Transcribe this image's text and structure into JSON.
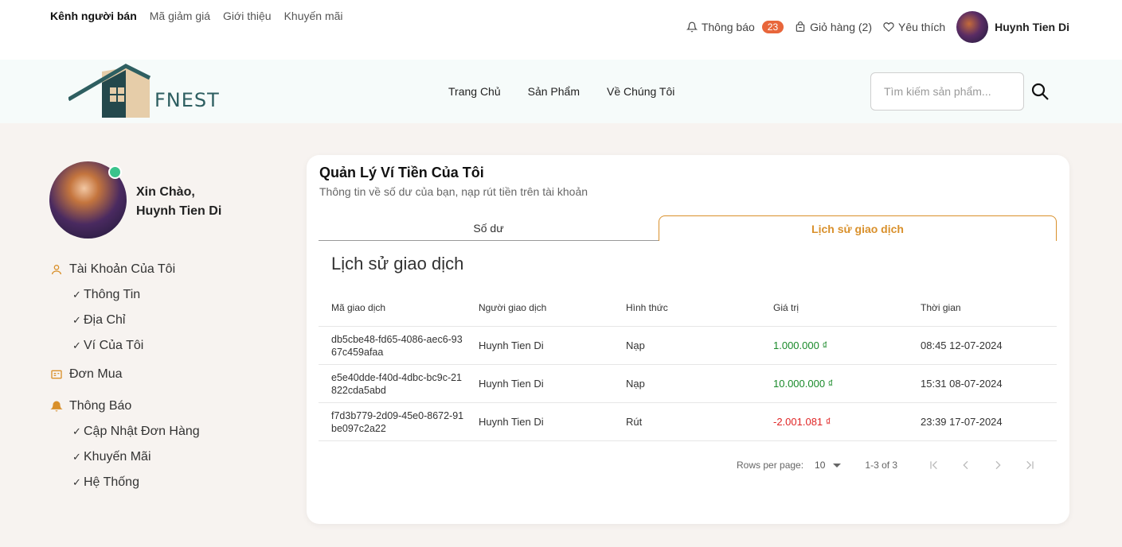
{
  "topbar": {
    "left_links": [
      "Kênh người bán",
      "Mã giảm giá",
      "Giới thiệu",
      "Khuyến mãi"
    ],
    "notifications_label": "Thông báo",
    "notifications_count": "23",
    "cart_label": "Giỏ hàng (2)",
    "favorites_label": "Yêu thích",
    "user_name": "Huynh Tien Di"
  },
  "nav": {
    "logo_text": "FNEST",
    "links": [
      "Trang Chủ",
      "Sản Phẩm",
      "Về Chúng Tôi"
    ],
    "search_placeholder": "Tìm kiếm sản phẩm..."
  },
  "sidebar": {
    "greeting_line1": "Xin Chào,",
    "greeting_line2": "Huynh Tien Di",
    "account": {
      "label": "Tài Khoản Của Tôi",
      "items": [
        "Thông Tin",
        "Địa Chỉ",
        "Ví Của Tôi"
      ]
    },
    "orders_label": "Đơn Mua",
    "notifications": {
      "label": "Thông Báo",
      "items": [
        "Cập Nhật Đơn Hàng",
        "Khuyến Mãi",
        "Hệ Thống"
      ]
    }
  },
  "card": {
    "title": "Quản Lý Ví Tiền Của Tôi",
    "subtitle": "Thông tin về số dư của bạn, nạp rút tiền trên tài khoản",
    "tabs": [
      "Số dư",
      "Lịch sử giao dịch"
    ],
    "active_tab": 1,
    "history_title": "Lịch sử giao dịch",
    "columns": [
      "Mã giao dịch",
      "Người giao dịch",
      "Hình thức",
      "Giá trị",
      "Thời gian"
    ],
    "rows": [
      [
        "db5cbe48-fd65-4086-aec6-9367c459afaa",
        "Huynh Tien Di",
        "Nạp",
        "1.000.000 ₫",
        "08:45 12-07-2024"
      ],
      [
        "e5e40dde-f40d-4dbc-bc9c-21822cda5abd",
        "Huynh Tien Di",
        "Nạp",
        "10.000.000 ₫",
        "15:31 08-07-2024"
      ],
      [
        "f7d3b779-2d09-45e0-8672-91be097c2a22",
        "Huynh Tien Di",
        "Rút",
        "-2.001.081 ₫",
        "23:39 17-07-2024"
      ]
    ],
    "pagination": {
      "rows_per_page_label": "Rows per page:",
      "rows_per_page": "10",
      "range": "1-3 of 3"
    }
  },
  "colors": {
    "accent": "#d9902b",
    "positive": "#1a8a2a",
    "negative": "#e02424",
    "badge": "#e8663b",
    "online": "#3ac38c"
  }
}
